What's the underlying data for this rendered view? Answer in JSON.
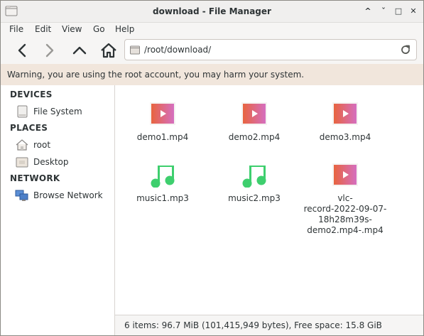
{
  "window": {
    "title": "download - File Manager",
    "controls": {
      "minimize": "^",
      "restore": "ˇ",
      "maximize": "□",
      "close": "✕"
    }
  },
  "menu": [
    "File",
    "Edit",
    "View",
    "Go",
    "Help"
  ],
  "toolbar": {
    "back_icon": "back-arrow-icon",
    "forward_icon": "forward-arrow-icon",
    "up_icon": "up-arrow-icon",
    "home_icon": "home-icon"
  },
  "location": {
    "path": "/root/download/"
  },
  "warning": {
    "text": "Warning, you are using the root account, you may harm your system."
  },
  "sidebar": {
    "sections": [
      {
        "heading": "DEVICES",
        "items": [
          {
            "label": "File System",
            "icon": "drive-icon"
          }
        ]
      },
      {
        "heading": "PLACES",
        "items": [
          {
            "label": "root",
            "icon": "home-folder-icon"
          },
          {
            "label": "Desktop",
            "icon": "desktop-folder-icon"
          }
        ]
      },
      {
        "heading": "NETWORK",
        "items": [
          {
            "label": "Browse Network",
            "icon": "network-icon"
          }
        ]
      }
    ]
  },
  "files": [
    {
      "name": "demo1.mp4",
      "type": "video"
    },
    {
      "name": "demo2.mp4",
      "type": "video"
    },
    {
      "name": "demo3.mp4",
      "type": "video"
    },
    {
      "name": "music1.mp3",
      "type": "audio"
    },
    {
      "name": "music2.mp3",
      "type": "audio"
    },
    {
      "name": "vlc-\nrecord-2022-09-07-\n18h28m39s-\ndemo2.mp4-.mp4",
      "type": "video"
    }
  ],
  "status": {
    "text": "6 items: 96.7 MiB (101,415,949 bytes), Free space: 15.8 GiB"
  },
  "colors": {
    "audio": "#3ecf6e",
    "video_start": "#e8643f",
    "video_end": "#d56fc0"
  }
}
